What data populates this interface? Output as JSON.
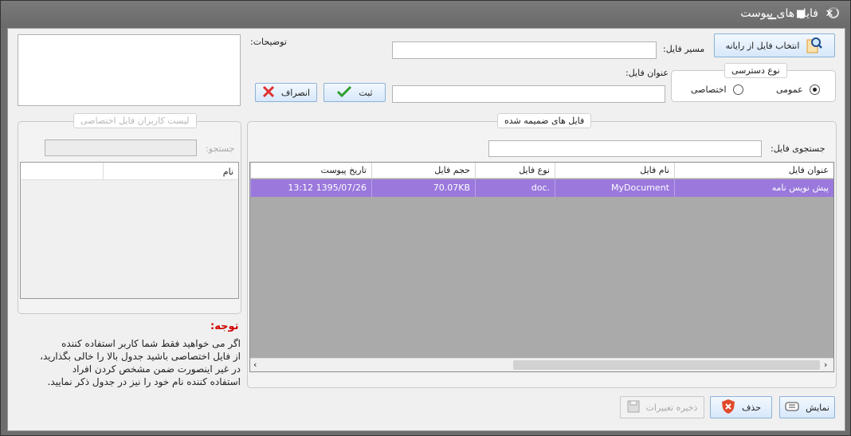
{
  "window": {
    "title": "فایل های پیوست",
    "controls": {
      "minimize": "▁",
      "maximize": "■",
      "close": "✕"
    }
  },
  "form": {
    "select_from_computer_label": "انتخاب فایل از رایانه",
    "file_path_label": "مسیر فایل:",
    "file_path_value": "",
    "file_title_label": "عنوان فایل:",
    "file_title_value": "",
    "description_label": "توضیحات:",
    "description_value": "",
    "access_type": {
      "caption": "نوع دسترسی",
      "options": [
        "عمومی",
        "اختصاصی"
      ],
      "selected": "عمومی"
    },
    "save_label": "ثبت",
    "cancel_label": "انصراف"
  },
  "private_users": {
    "caption": "لیست کاربران فایل اختصاصی",
    "search_label": "جستجو:",
    "search_value": "",
    "column_name": "نام"
  },
  "attached_files": {
    "caption": "فایل های ضمیمه شده",
    "search_label": "جستجوی فایل:",
    "search_value": "",
    "columns": [
      "عنوان فایل",
      "نام فایل",
      "نوع فایل",
      "حجم فایل",
      "تاریخ پیوست"
    ],
    "rows": [
      [
        "پیش نویس نامه",
        "MyDocument",
        ".doc",
        "70.07KB",
        "1395/07/26 13:12"
      ]
    ]
  },
  "note": {
    "title": "توجه:",
    "lines": [
      "اگر می خواهید فقط شما کاربر استفاده کننده",
      "از فایل اختصاصی باشید جدول بالا را خالی بگذارید،",
      "در غیر اینصورت ضمن مشخص کردن افراد",
      "استفاده کننده نام خود را نیز در جدول ذکر نمایید."
    ]
  },
  "footer": {
    "show_label": "نمایش",
    "delete_label": "حذف",
    "save_changes_label": "ذخیره تغییرات"
  },
  "colors": {
    "selected_row": "#9a78dc",
    "note_title": "#d00000",
    "button_border": "#8db2d8"
  }
}
